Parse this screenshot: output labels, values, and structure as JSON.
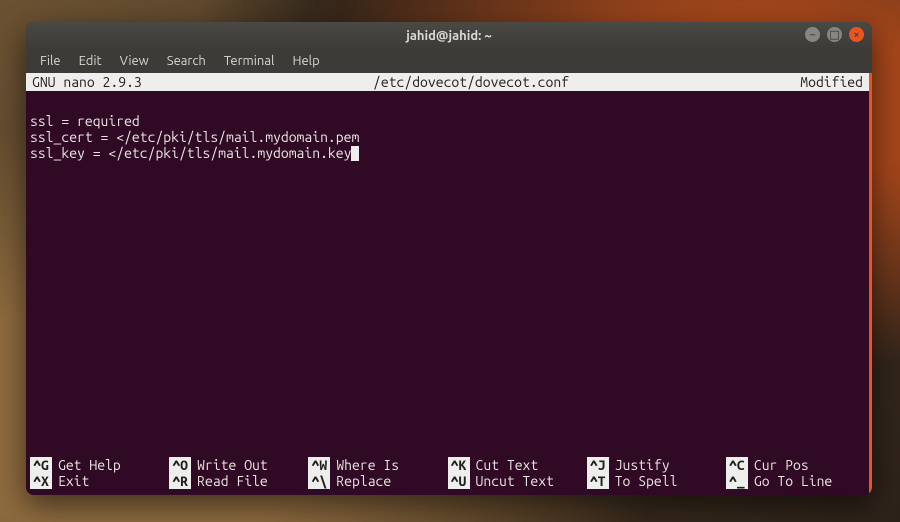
{
  "window": {
    "title": "jahid@jahid: ~",
    "controls": {
      "min": "–",
      "max": "□",
      "close": "×"
    }
  },
  "menubar": [
    "File",
    "Edit",
    "View",
    "Search",
    "Terminal",
    "Help"
  ],
  "nano": {
    "status_left": "GNU nano 2.9.3",
    "status_center": "/etc/dovecot/dovecot.conf",
    "status_right": "Modified",
    "lines": [
      "",
      "ssl = required",
      "ssl_cert = </etc/pki/tls/mail.mydomain.pem",
      "ssl_key = </etc/pki/tls/mail.mydomain.key"
    ],
    "shortcuts": {
      "row1": [
        {
          "key": "^G",
          "label": "Get Help"
        },
        {
          "key": "^O",
          "label": "Write Out"
        },
        {
          "key": "^W",
          "label": "Where Is"
        },
        {
          "key": "^K",
          "label": "Cut Text"
        },
        {
          "key": "^J",
          "label": "Justify"
        },
        {
          "key": "^C",
          "label": "Cur Pos"
        }
      ],
      "row2": [
        {
          "key": "^X",
          "label": "Exit"
        },
        {
          "key": "^R",
          "label": "Read File"
        },
        {
          "key": "^\\",
          "label": "Replace"
        },
        {
          "key": "^U",
          "label": "Uncut Text"
        },
        {
          "key": "^T",
          "label": "To Spell"
        },
        {
          "key": "^_",
          "label": "Go To Line"
        }
      ]
    }
  }
}
